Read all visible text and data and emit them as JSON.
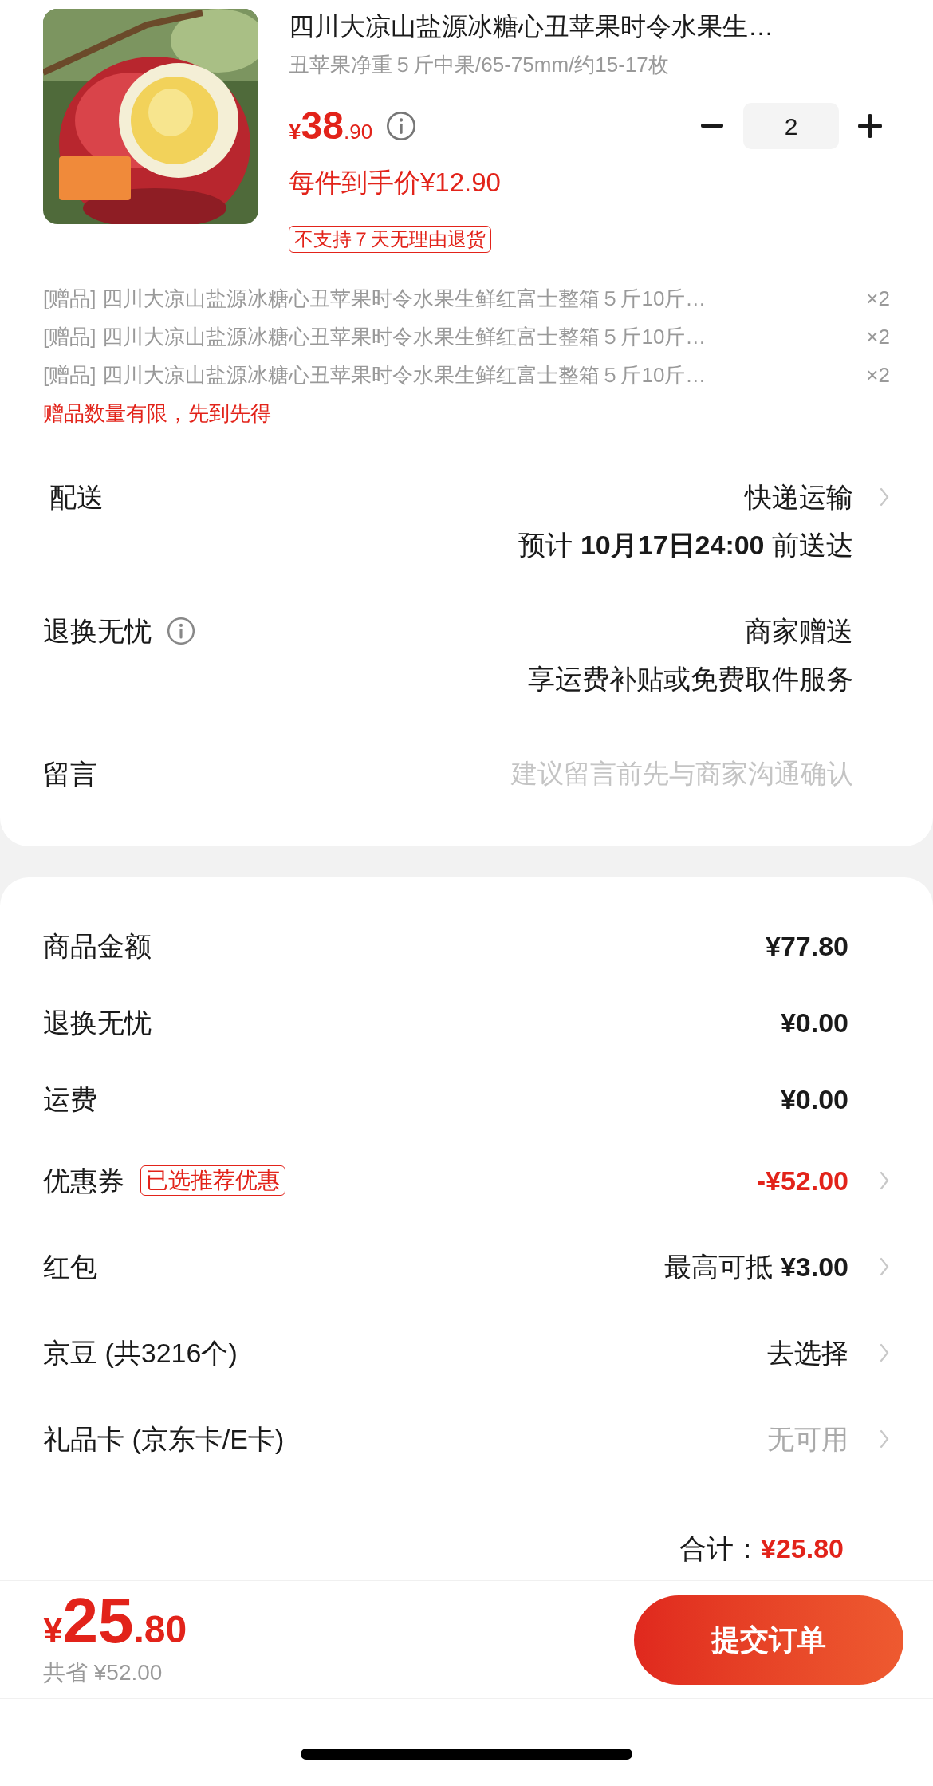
{
  "product": {
    "title": "四川大凉山盐源冰糖心丑苹果时令水果生…",
    "spec": "丑苹果净重５斤中果/65-75mm/约15-17枚",
    "price": {
      "currency": "¥",
      "integer": "38",
      "decimal": ".90"
    },
    "quantity": "2",
    "unit_price_note": "每件到手价¥12.90",
    "return_tag": "不支持７天无理由退货"
  },
  "gifts": [
    {
      "label": "[赠品]",
      "name": "四川大凉山盐源冰糖心丑苹果时令水果生鲜红富士整箱５斤10斤…",
      "count": "×2"
    },
    {
      "label": "[赠品]",
      "name": "四川大凉山盐源冰糖心丑苹果时令水果生鲜红富士整箱５斤10斤…",
      "count": "×2"
    },
    {
      "label": "[赠品]",
      "name": "四川大凉山盐源冰糖心丑苹果时令水果生鲜红富士整箱５斤10斤…",
      "count": "×2"
    }
  ],
  "gift_notice": "赠品数量有限，先到先得",
  "services": [
    {
      "kind": "delivery",
      "label": "配送",
      "value": "快递运输",
      "detail": "预计 **10月17日24:00** 前送达",
      "info": false,
      "chevron": true
    },
    {
      "kind": "return",
      "label": "退换无忧",
      "value": "商家赠送",
      "detail": "享运费补贴或免费取件服务",
      "info": true,
      "chevron": false
    },
    {
      "kind": "message",
      "label": "留言",
      "placeholder": "建议留言前先与商家沟通确认"
    }
  ],
  "summary": [
    {
      "label": "商品金额",
      "value": "¥77.80",
      "kind": "normal",
      "chevron": false
    },
    {
      "label": "退换无忧",
      "value": "¥0.00",
      "kind": "normal",
      "chevron": false
    },
    {
      "label": "运费",
      "value": "¥0.00",
      "kind": "normal",
      "chevron": false
    },
    {
      "label": "优惠券",
      "tag": "已选推荐优惠",
      "value": "-¥52.00",
      "kind": "discount",
      "chevron": true
    },
    {
      "label": "红包",
      "value": "最高可抵 **¥3.00**",
      "kind": "plain",
      "chevron": true
    },
    {
      "label": "京豆 (共3216个)",
      "value": "去选择",
      "kind": "plain",
      "chevron": true
    },
    {
      "label": "礼品卡 (京东卡/E卡)",
      "value": "无可用",
      "kind": "muted",
      "chevron": true
    }
  ],
  "total": {
    "label": "合计：",
    "value": "¥25.80"
  },
  "bottom_bar": {
    "currency": "¥",
    "integer": "25",
    "decimal": ".80",
    "saved": "共省 ¥52.00",
    "submit": "提交订单"
  }
}
